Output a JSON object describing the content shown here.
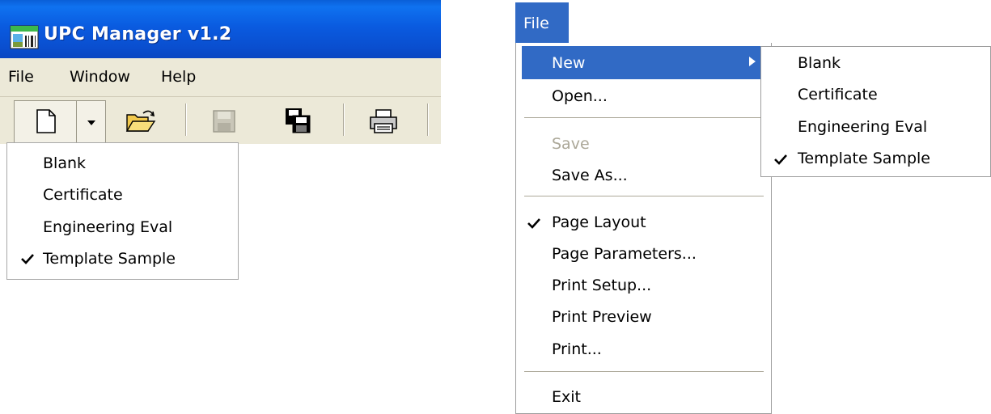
{
  "window": {
    "title": "UPC Manager v1.2",
    "accent_color": "#0a5be0"
  },
  "menubar": {
    "items": [
      {
        "label": "File"
      },
      {
        "label": "Window"
      },
      {
        "label": "Help"
      }
    ]
  },
  "toolbar": {
    "buttons": [
      {
        "icon": "new-document-icon",
        "enabled": true
      },
      {
        "icon": "dropdown-arrow-icon",
        "enabled": true
      },
      {
        "icon": "open-folder-icon",
        "enabled": true
      },
      {
        "icon": "save-disk-icon",
        "enabled": false
      },
      {
        "icon": "save-all-icon",
        "enabled": true
      },
      {
        "icon": "printer-icon",
        "enabled": true
      }
    ]
  },
  "new_dropdown": {
    "items": [
      {
        "label": "Blank",
        "checked": false
      },
      {
        "label": "Certificate",
        "checked": false
      },
      {
        "label": "Engineering Eval",
        "checked": false
      },
      {
        "label": "Template Sample",
        "checked": true
      }
    ]
  },
  "file_menu": {
    "header": "File",
    "highlight_color": "#316ac5",
    "items": [
      {
        "label": "New",
        "submenu": true,
        "highlighted": true
      },
      {
        "label": "Open..."
      },
      {
        "label": "Save",
        "disabled": true
      },
      {
        "label": "Save As..."
      },
      {
        "label": "Page Layout",
        "checked": true
      },
      {
        "label": "Page Parameters..."
      },
      {
        "label": "Print Setup..."
      },
      {
        "label": "Print Preview"
      },
      {
        "label": "Print..."
      },
      {
        "label": "Exit"
      }
    ]
  },
  "new_submenu": {
    "items": [
      {
        "label": "Blank",
        "checked": false
      },
      {
        "label": "Certificate",
        "checked": false
      },
      {
        "label": "Engineering Eval",
        "checked": false
      },
      {
        "label": "Template Sample",
        "checked": true
      }
    ]
  }
}
